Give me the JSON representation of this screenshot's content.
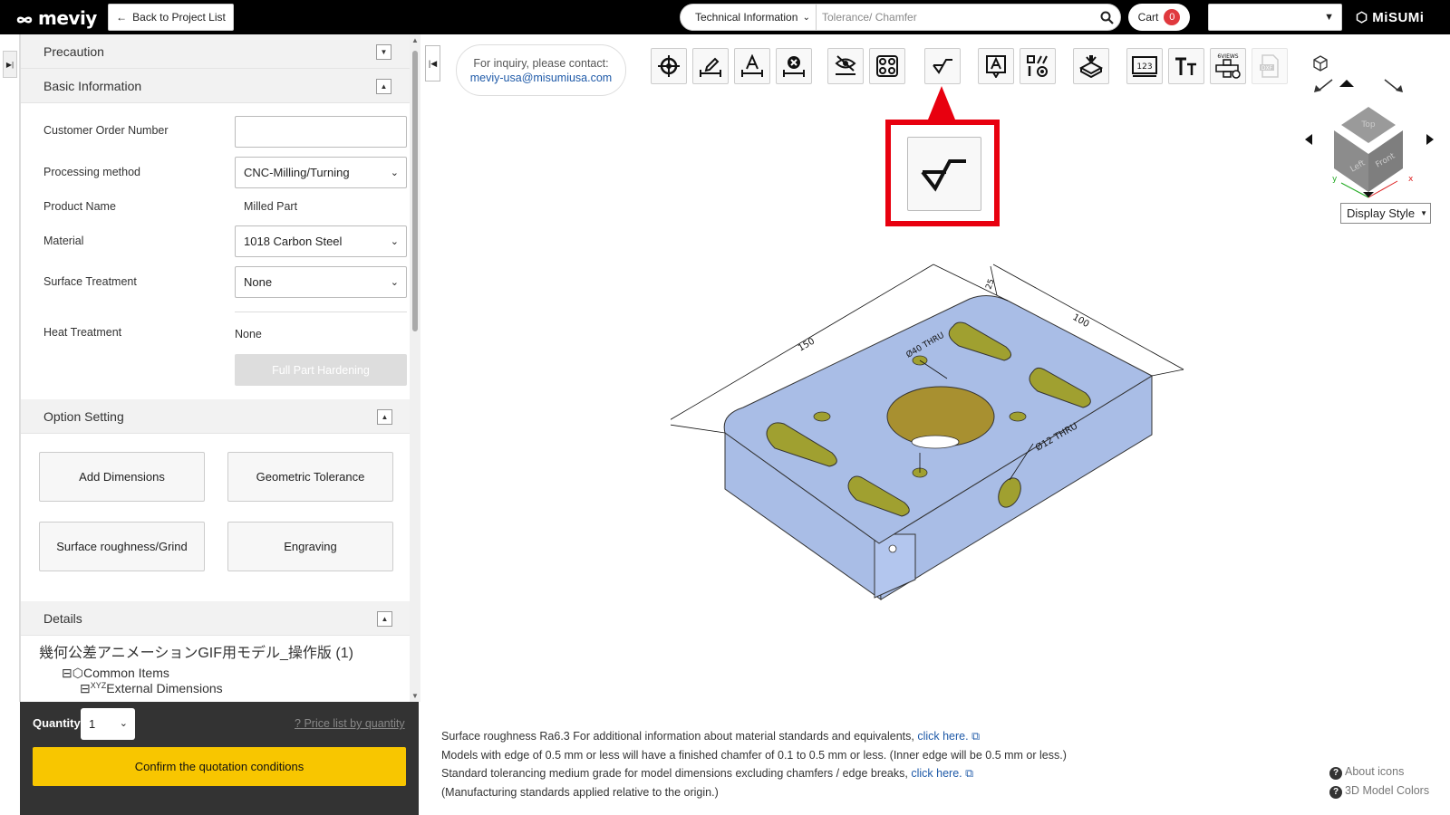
{
  "header": {
    "logo_text": "meviy",
    "back_label": "Back to Project List",
    "search_category": "Technical Information",
    "search_placeholder": "Tolerance/ Chamfer",
    "cart_label": "Cart",
    "cart_count": "0",
    "brand": "MiSUMi"
  },
  "left": {
    "sections": {
      "precaution": "Precaution",
      "basic": "Basic Information",
      "option": "Option Setting",
      "details": "Details"
    },
    "form": {
      "order_number_label": "Customer Order Number",
      "order_number_value": "",
      "processing_label": "Processing method",
      "processing_value": "CNC-Milling/Turning",
      "product_label": "Product Name",
      "product_value": "Milled Part",
      "material_label": "Material",
      "material_value": "1018 Carbon Steel",
      "surface_label": "Surface Treatment",
      "surface_value": "None",
      "heat_label": "Heat Treatment",
      "heat_value": "None",
      "hardening_label": "Full Part Hardening"
    },
    "options": {
      "add_dimensions": "Add Dimensions",
      "geometric_tolerance": "Geometric Tolerance",
      "surface_roughness": "Surface roughness/Grind",
      "engraving": "Engraving"
    },
    "tree": {
      "model_name": "幾何公差アニメーションGIF用モデル_操作版 (1)",
      "common_items": "Common Items",
      "external_dimensions": "External Dimensions"
    },
    "quantity_label": "Quantity",
    "quantity_value": "1",
    "price_link": "Price list by quantity",
    "confirm_label": "Confirm the quotation conditions"
  },
  "viewer": {
    "inquiry_line1": "For inquiry, please contact:",
    "inquiry_email": "meviy-usa@misumiusa.com",
    "display_style": "Display Style",
    "dimensions": {
      "d150": "150",
      "d100": "100",
      "d25": "25",
      "hole_label": "Ø12 THRU",
      "hole2_label": "Ø40 THRU"
    },
    "notes": {
      "line1": "Surface roughness Ra6.3    For additional information about material standards and equivalents,",
      "line1_link": "click here.",
      "line2": "Models with edge of 0.5 mm or less will have a finished chamfer of 0.1 to 0.5 mm or less. (Inner edge will be 0.5 mm or less.)",
      "line3": "Standard tolerancing medium grade for model dimensions excluding chamfers / edge breaks,",
      "line3_link": "click here.",
      "line4": "(Manufacturing standards applied relative to the origin.)"
    },
    "help": {
      "about_icons": "About icons",
      "model_colors": "3D Model Colors"
    }
  },
  "colors": {
    "accent_yellow": "#f8c600",
    "highlight_red": "#e8000f",
    "part_blue": "#a9bde6",
    "hole_olive": "#a0a030"
  }
}
